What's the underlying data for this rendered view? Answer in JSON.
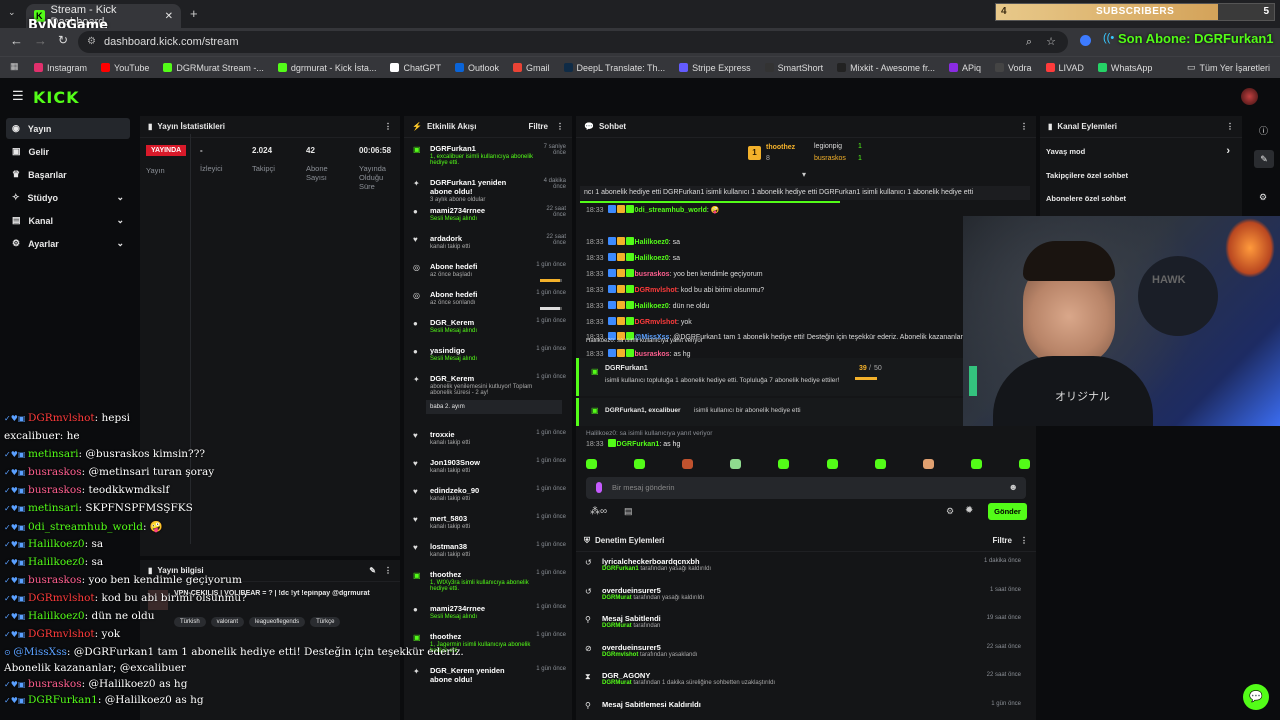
{
  "browser": {
    "tab_title": "Stream - Kick Dashboard",
    "watermark": "ByNoGame",
    "url": "dashboard.kick.com/stream",
    "bookmarks": [
      {
        "label": "Instagram",
        "color": "#e1306c"
      },
      {
        "label": "YouTube",
        "color": "#ff0000"
      },
      {
        "label": "DGRMurat Stream -...",
        "color": "#53fc18"
      },
      {
        "label": "dgrmurat - Kick İsta...",
        "color": "#53fc18"
      },
      {
        "label": "ChatGPT",
        "color": "#ffffff"
      },
      {
        "label": "Outlook",
        "color": "#0a64d8"
      },
      {
        "label": "Gmail",
        "color": "#ea4335"
      },
      {
        "label": "DeepL Translate: Th...",
        "color": "#0f2b46"
      },
      {
        "label": "Stripe Express",
        "color": "#635bff"
      },
      {
        "label": "SmartShort",
        "color": "#333333"
      },
      {
        "label": "Mixkit - Awesome fr...",
        "color": "#222222"
      },
      {
        "label": "APiq",
        "color": "#8a2be2"
      },
      {
        "label": "Vodra",
        "color": "#444444"
      },
      {
        "label": "LIVAD",
        "color": "#ff3b3b"
      },
      {
        "label": "WhatsApp",
        "color": "#25d366"
      }
    ],
    "all_bookmarks": "Tüm Yer İşaretleri"
  },
  "overlay": {
    "subscribers_left": "4",
    "subscribers_label": "SUBSCRIBERS",
    "subscribers_right": "5",
    "last_sub": "Son Abone: DGRFurkan1"
  },
  "sidebar": {
    "items": [
      {
        "label": "Yayın",
        "icon": "video-icon",
        "active": true,
        "chev": false
      },
      {
        "label": "Gelir",
        "icon": "money-icon",
        "active": false,
        "chev": false
      },
      {
        "label": "Başarılar",
        "icon": "trophy-icon",
        "active": false,
        "chev": false
      },
      {
        "label": "Stüdyo",
        "icon": "studio-icon",
        "active": false,
        "chev": true
      },
      {
        "label": "Kanal",
        "icon": "channel-icon",
        "active": false,
        "chev": true
      },
      {
        "label": "Ayarlar",
        "icon": "gear-icon",
        "active": false,
        "chev": true
      }
    ]
  },
  "stats": {
    "title": "Yayın İstatistikleri",
    "live_badge": "YAYINDA",
    "live_label": "Yayın",
    "viewers_value": "-",
    "viewers_label": "İzleyici",
    "followers_value": "2.024",
    "followers_label": "Takipçi",
    "subs_value": "42",
    "subs_label": "Abone Sayısı",
    "duration_value": "00:06:58",
    "duration_label": "Yayında Olduğu Süre"
  },
  "stream_info": {
    "title": "Yayın bilgisi",
    "stream_title": "VPN-ÇEKİLİŞ | VOLİBEAR = ? | !dc !yt !epinpay @dgrmurat",
    "tags": [
      "Türkish",
      "valorant",
      "leagueoflegends",
      "Türkçe"
    ]
  },
  "activity": {
    "title": "Etkinlik Akışı",
    "filter": "Filtre",
    "items": [
      {
        "title": "DGRFurkan1",
        "sub": "1, excalibuer isimli kullanıcıya abonelik hediye etti.",
        "time": "7 saniye önce",
        "icon": "gift-icon"
      },
      {
        "title": "DGRFurkan1 yeniden abone oldu!",
        "sub": "3 aylık abone oldular",
        "time": "4 dakika önce",
        "icon": "star-icon"
      },
      {
        "title": "mami2734rrnee",
        "sub": "Sesli Mesaj alındı",
        "time": "22 saat önce",
        "icon": "voice-icon"
      },
      {
        "title": "ardadork",
        "sub": "kanalı takip etti",
        "time": "22 saat önce",
        "icon": "heart-icon"
      },
      {
        "title": "Abone hedefi",
        "sub": "az önce başladı",
        "time": "1 gün önce",
        "icon": "target-icon",
        "progress": 0.9
      },
      {
        "title": "Abone hedefi",
        "sub": "az önce sonlandı",
        "time": "1 gün önce",
        "icon": "target-icon",
        "progress": 0.9
      },
      {
        "title": "DGR_Kerem",
        "sub": "Sesli Mesaj alındı",
        "time": "1 gün önce",
        "icon": "voice-icon"
      },
      {
        "title": "yasindigo",
        "sub": "Sesli Mesaj alındı",
        "time": "1 gün önce",
        "icon": "voice-icon"
      },
      {
        "title": "DGR_Kerem",
        "sub": "abonelik yenilemesini kutluyor! Toplam abonelik süresi - 2 ay!",
        "time": "1 gün önce",
        "icon": "star-icon",
        "quote": "baba 2. ayım"
      },
      {
        "title": "troxxie",
        "sub": "kanalı takip etti",
        "time": "1 gün önce",
        "icon": "heart-icon"
      },
      {
        "title": "Jon1903Snow",
        "sub": "kanalı takip etti",
        "time": "1 gün önce",
        "icon": "heart-icon"
      },
      {
        "title": "edindzeko_90",
        "sub": "kanalı takip etti",
        "time": "1 gün önce",
        "icon": "heart-icon"
      },
      {
        "title": "mert_5803",
        "sub": "kanalı takip etti",
        "time": "1 gün önce",
        "icon": "heart-icon"
      },
      {
        "title": "lostman38",
        "sub": "kanalı takip etti",
        "time": "1 gün önce",
        "icon": "heart-icon"
      },
      {
        "title": "thoothez",
        "sub": "1, WtXy3ra isimli kullanıcıya abonelik hediye etti.",
        "time": "1 gün önce",
        "icon": "gift-icon"
      },
      {
        "title": "mami2734rrnee",
        "sub": "Sesli Mesaj alındı",
        "time": "1 gün önce",
        "icon": "voice-icon"
      },
      {
        "title": "thoothez",
        "sub": "1, Jagermin isimli kullanıcıya abonelik hediye etti.",
        "time": "1 gün önce",
        "icon": "gift-icon"
      },
      {
        "title": "DGR_Kerem yeniden abone oldu!",
        "sub": "",
        "time": "1 gün önce",
        "icon": "star-icon"
      }
    ]
  },
  "chat": {
    "title": "Sohbet",
    "leaderboard": {
      "top": "thoothez",
      "top_count": "8",
      "second": "legionpig",
      "second_count": "1",
      "third": "busraskos",
      "third_count": "1"
    },
    "ticker": "ncı 1 abonelik hediye etti  DGRFurkan1 isimli kullanıcı 1 abonelik hediye etti  DGRFurkan1 isimli kullanıcı 1 abonelik hediye etti",
    "messages": [
      {
        "time": "18:33",
        "user": "0di_streamhub_world",
        "color": "#53fc18",
        "text": "🤪"
      },
      {
        "time": "18:33",
        "user": "Halilkoez0",
        "color": "#53fc18",
        "text": "sa"
      },
      {
        "time": "18:33",
        "user": "Halilkoez0",
        "color": "#53fc18",
        "text": "sa"
      },
      {
        "time": "18:33",
        "user": "busraskos",
        "color": "#ff5f8f",
        "text": "yoo ben kendimle geçiyorum"
      },
      {
        "time": "18:33",
        "user": "DGRmvlshot",
        "color": "#ff3b3b",
        "text": "kod bu abi birimi olsunmu?"
      },
      {
        "time": "18:33",
        "user": "Halilkoez0",
        "color": "#53fc18",
        "text": "dün ne oldu"
      },
      {
        "time": "18:33",
        "user": "DGRmvlshot",
        "color": "#ff3b3b",
        "text": "yok"
      },
      {
        "time": "18:33",
        "user": "@MissXss",
        "color": "#5aa0ff",
        "text": "@DGRFurkan1 tam 1 abonelik hediye etti! Desteğin için teşekkür ederiz. Abonelik kazananlar; @e"
      },
      {
        "time": "18:33",
        "user": "busraskos",
        "color": "#ff5f8f",
        "text": "as hg",
        "reply": "Halilkoez0: sa isimli kullanıcıya yanıt veriyor"
      }
    ],
    "gift_event": {
      "user": "DGRFurkan1",
      "text": "isimli kullanıcı topluluğa 1 abonelik hediye etti. Topluluğa 7 abonelik hediye ettiler!",
      "progress": "39",
      "total": "50"
    },
    "gift_event2": {
      "user": "DGRFurkan1, excalibuer",
      "text": "isimli kullanıcı bir abonelik hediye etti"
    },
    "last_reply": "Halilkoez0: sa isimli kullanıcıya yanıt veriyor",
    "last_msg": {
      "time": "18:33",
      "user": "DGRFurkan1",
      "text": "as hg"
    },
    "input_placeholder": "Bir mesaj gönderin",
    "send": "Gönder"
  },
  "channel_actions": {
    "title": "Kanal Eylemleri",
    "items": [
      "Yavaş mod",
      "Takipçilere özel sohbet",
      "Abonelere özel sohbet"
    ]
  },
  "moderation": {
    "title": "Denetim Eylemleri",
    "filter": "Filtre",
    "items": [
      {
        "title": "lyricalcheckerboardqcnxbh",
        "user": "DGRFurkan1",
        "sub": "tarafından yasağı kaldırıldı",
        "time": "1 dakika önce",
        "icon": "undo-icon"
      },
      {
        "title": "overdueinsurer5",
        "user": "DGRMurat",
        "sub": "tarafından yasağı kaldırıldı",
        "time": "1 saat önce",
        "icon": "undo-icon"
      },
      {
        "title": "Mesaj Sabitlendi",
        "user": "DGRMurat",
        "sub": "tarafından",
        "time": "19 saat önce",
        "icon": "pin-icon"
      },
      {
        "title": "overdueinsurer5",
        "user": "DGRmvlshot",
        "sub": "tarafından yasaklandı",
        "time": "22 saat önce",
        "icon": "ban-icon"
      },
      {
        "title": "DGR_AGONY",
        "user": "DGRMurat",
        "sub": "tarafından 1 dakika süreliğine sohbetten uzaklaştırıldı",
        "time": "22 saat önce",
        "icon": "timer-icon"
      },
      {
        "title": "Mesaj Sabitlemesi Kaldırıldı",
        "user": "",
        "sub": "",
        "time": "1 gün önce",
        "icon": "pin-icon"
      }
    ]
  },
  "overlay_chat": [
    {
      "user": "DGRmvlshot",
      "color": "#ff3b3b",
      "text": "hepsi"
    },
    {
      "user": "excalibuer",
      "color": "#ffffff",
      "text": "he"
    },
    {
      "user": "metinsari",
      "color": "#53fc18",
      "text": "@busraskos kimsin???"
    },
    {
      "user": "busraskos",
      "color": "#ff5f8f",
      "text": "@metinsari turan şoray"
    },
    {
      "user": "busraskos",
      "color": "#ff5f8f",
      "text": "teodkkwmdkslf"
    },
    {
      "user": "metinsari",
      "color": "#53fc18",
      "text": "SKPFNSPFMSŞFKS"
    },
    {
      "user": "0di_streamhub_world",
      "color": "#53fc18",
      "text": "🤪"
    },
    {
      "user": "Halilkoez0",
      "color": "#53fc18",
      "text": "sa"
    },
    {
      "user": "Halilkoez0",
      "color": "#53fc18",
      "text": "sa"
    },
    {
      "user": "busraskos",
      "color": "#ff5f8f",
      "text": "yoo ben kendimle geçiyorum"
    },
    {
      "user": "DGRmvlshot",
      "color": "#ff3b3b",
      "text": "kod bu abi birimi olsunmu?"
    },
    {
      "user": "Halilkoez0",
      "color": "#53fc18",
      "text": "dün ne oldu"
    },
    {
      "user": "DGRmvlshot",
      "color": "#ff3b3b",
      "text": "yok"
    },
    {
      "user": "@MissXss",
      "color": "#5aa0ff",
      "text": "@DGRFurkan1 tam 1 abonelik hediye etti! Desteğin için teşekkür ederiz."
    },
    {
      "user": "",
      "color": "#ffffff",
      "text": "Abonelik kazananlar; @excalibuer"
    },
    {
      "user": "busraskos",
      "color": "#ff5f8f",
      "text": "@Halilkoez0 as hg"
    },
    {
      "user": "DGRFurkan1",
      "color": "#53fc18",
      "text": "@Halilkoez0 as hg"
    }
  ],
  "webcam": {
    "shirt_text": "オリジナル",
    "cap_text": "HAWK"
  }
}
